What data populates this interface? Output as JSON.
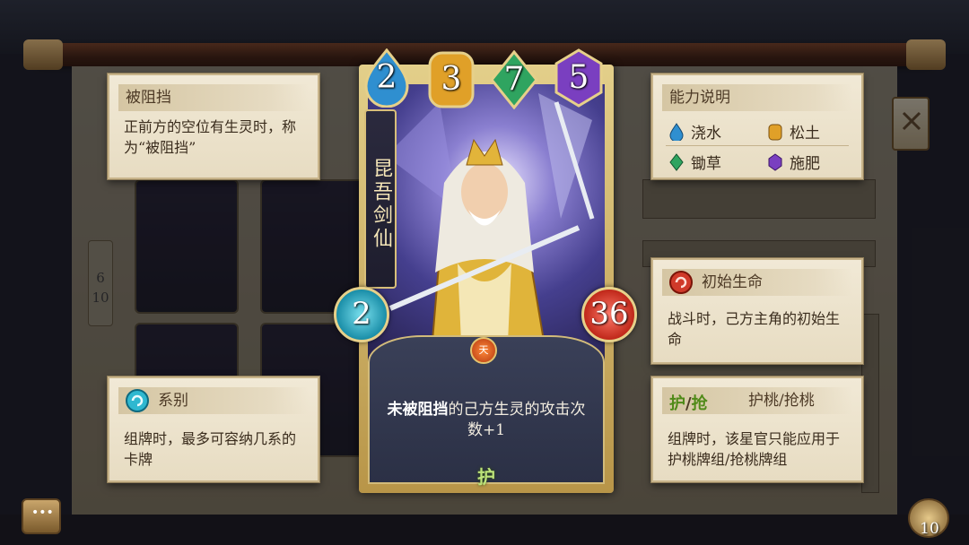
{
  "card": {
    "name": "昆吾剑仙",
    "cost_gems": [
      {
        "value": "2",
        "type": "water",
        "color": "#2f8fd0"
      },
      {
        "value": "3",
        "type": "soil",
        "color": "#e0a028"
      },
      {
        "value": "7",
        "type": "weed",
        "color": "#2fa460"
      },
      {
        "value": "5",
        "type": "fertilize",
        "color": "#7a3fc0"
      }
    ],
    "series_value": "2",
    "life_value": "36",
    "series_badge": "天",
    "description_emphasis": "未被阻挡",
    "description_rest": "的己方生灵的攻击次数+1",
    "keyword": "护"
  },
  "panels": {
    "blocked": {
      "title": "被阻挡",
      "body": "正前方的空位有生灵时，称为“被阻挡”"
    },
    "ability": {
      "title": "能力说明",
      "items": [
        {
          "label": "浇水",
          "icon": "water-drop-icon",
          "color": "#2f8fd0"
        },
        {
          "label": "松土",
          "icon": "soil-icon",
          "color": "#e0a028"
        },
        {
          "label": "锄草",
          "icon": "weed-icon",
          "color": "#2fa460"
        },
        {
          "label": "施肥",
          "icon": "fertilize-icon",
          "color": "#7a3fc0"
        }
      ]
    },
    "initial_life": {
      "title": "初始生命",
      "body": "战斗时，己方主角的初始生命"
    },
    "series": {
      "title": "系别",
      "body": "组牌时，最多可容纳几系的卡牌"
    },
    "protect": {
      "badge_1": "护",
      "badge_sep": "/",
      "badge_2": "抢",
      "title": "护桃/抢桃",
      "body": "组牌时，该星官只能应用于护桃牌组/抢桃牌组"
    }
  },
  "background": {
    "page_top": "6",
    "page_bottom": "10"
  },
  "currency": {
    "count": "10"
  }
}
